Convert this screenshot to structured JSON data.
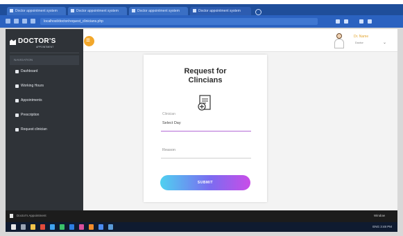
{
  "browser": {
    "tabs": [
      {
        "label": "Doctor appointment system"
      },
      {
        "label": "Doctor appointment system"
      },
      {
        "label": "Doctor appointment system"
      },
      {
        "label": "Doctor appointment system"
      }
    ],
    "url": "localhost/doctor/request_clinicians.php"
  },
  "sidebar": {
    "logo_text": "DOCTOR'S",
    "logo_sub": "APPOINTMENT",
    "section_label": "NAVIGATION",
    "items": [
      {
        "label": "Dashboard",
        "icon": "home-icon"
      },
      {
        "label": "Working Hours",
        "icon": "clock-icon"
      },
      {
        "label": "Appointments",
        "icon": "calendar-icon"
      },
      {
        "label": "Prescription",
        "icon": "file-icon"
      },
      {
        "label": "Request clinician",
        "icon": "user-icon"
      }
    ]
  },
  "topbar": {
    "user_name": "Dr. Name",
    "user_role": "Doctor"
  },
  "form": {
    "title": "Request for\nClincians",
    "field1_label": "Clinician",
    "field1_value": "Select Day",
    "field2_placeholder": "Reason",
    "submit_label": "SUBMIT"
  },
  "footer_strip": {
    "left_text": "Doctor's Appointment",
    "right_text": "Window"
  },
  "taskbar": {
    "tray_text": "ENG  3:48 PM"
  },
  "colors": {
    "accent_orange": "#f2a72b",
    "sidebar_bg": "#2f3338",
    "field_focus": "#b36ad6",
    "button_gradient_start": "#4fd1f0",
    "button_gradient_end": "#c94de8"
  }
}
